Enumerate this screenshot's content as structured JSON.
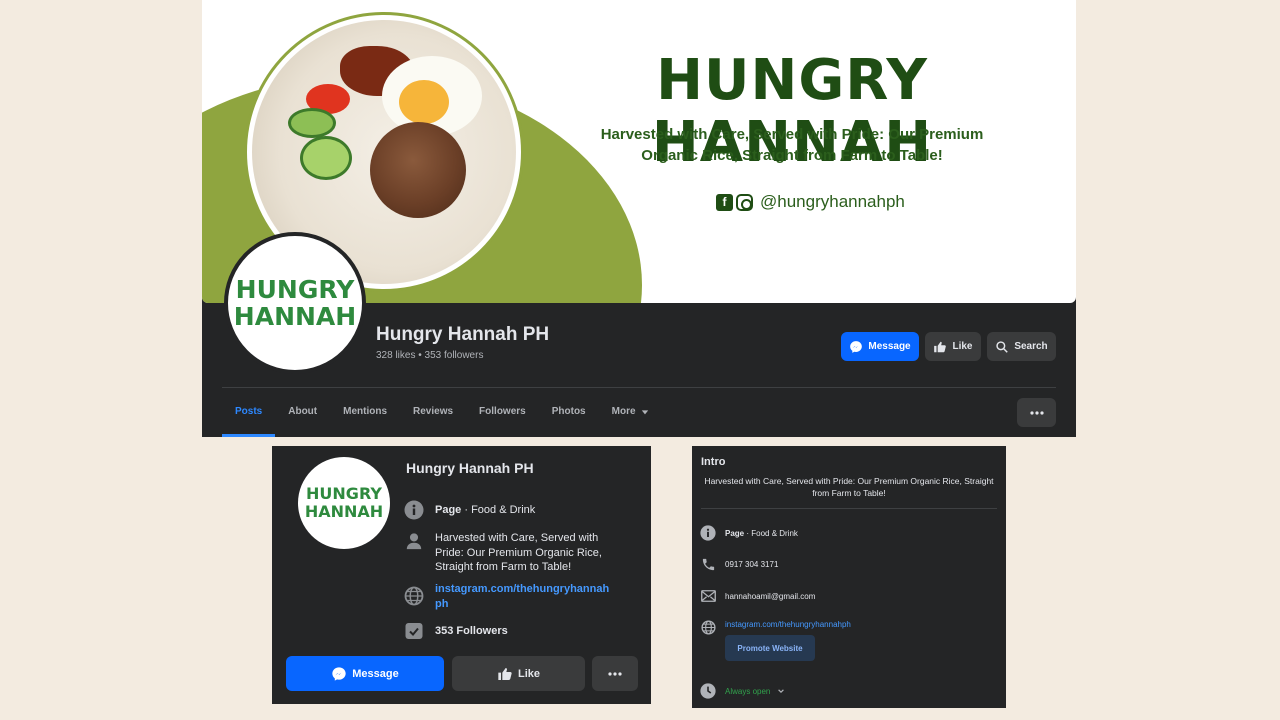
{
  "cover": {
    "brand": "HUNGRY HANNAH",
    "tagline_line1": "Harvested with Care, Served with Pride: Our Premium",
    "tagline_line2": "Organic Rice, Straight from Farm to Table!",
    "facebook_glyph": "f",
    "handle": "@hungryhannahph"
  },
  "logo": {
    "line1": "HUNGRY",
    "line2": "HANNAH"
  },
  "header": {
    "name": "Hungry Hannah PH",
    "stats": "328 likes • 353 followers",
    "buttons": {
      "message": "Message",
      "like": "Like",
      "search": "Search"
    }
  },
  "nav": {
    "tabs": [
      "Posts",
      "About",
      "Mentions",
      "Reviews",
      "Followers",
      "Photos",
      "More"
    ]
  },
  "card_left": {
    "title": "Hungry Hannah PH",
    "category_bold": "Page",
    "category_rest": " · Food & Drink",
    "bio": "Harvested with Care, Served with Pride: Our Premium Organic Rice, Straight from Farm to Table!",
    "website": "instagram.com/thehungryhannahph",
    "followers": "353 Followers",
    "buttons": {
      "message": "Message",
      "like": "Like"
    }
  },
  "intro": {
    "title": "Intro",
    "bio": "Harvested with Care, Served with Pride: Our Premium Organic Rice, Straight from Farm to Table!",
    "category_bold": "Page",
    "category_rest": " · Food & Drink",
    "phone": "0917 304 3171",
    "email": "hannahoamil@gmail.com",
    "website": "instagram.com/thehungryhannahph",
    "promote_button": "Promote Website",
    "hours": "Always open"
  },
  "colors": {
    "panel_bg": "#242526",
    "accent_blue": "#0866ff",
    "brand_green": "#1f4d14",
    "logo_green": "#2e8a3e",
    "cover_olive": "#8fa53f",
    "page_bg": "#f3ebe0"
  },
  "icons": [
    "messenger-icon",
    "thumbs-up-icon",
    "search-icon",
    "caret-down-icon",
    "more-dots-icon",
    "info-icon",
    "person-icon",
    "globe-icon",
    "followers-check-icon",
    "phone-icon",
    "mail-icon",
    "clock-icon",
    "facebook-icon",
    "instagram-icon"
  ]
}
